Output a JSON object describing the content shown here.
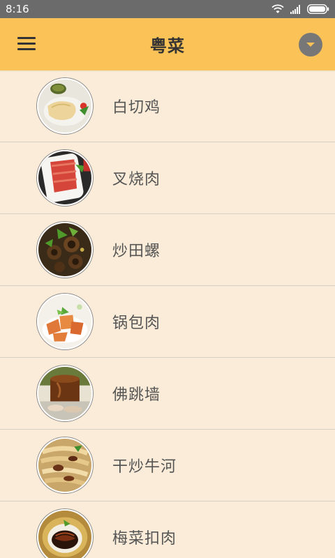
{
  "status_bar": {
    "time": "8:16"
  },
  "app_bar": {
    "title": "粤菜"
  },
  "dishes": [
    {
      "name": "白切鸡",
      "image": "white-cut-chicken"
    },
    {
      "name": "叉烧肉",
      "image": "char-siu-pork"
    },
    {
      "name": "炒田螺",
      "image": "stir-fried-snails"
    },
    {
      "name": "锅包肉",
      "image": "sweet-sour-pork"
    },
    {
      "name": "佛跳墙",
      "image": "buddha-jumps-wall"
    },
    {
      "name": "干炒牛河",
      "image": "beef-chow-fun"
    },
    {
      "name": "梅菜扣肉",
      "image": "braised-pork-preserved-veg"
    }
  ],
  "colors": {
    "status_bar": "#6b6b6b",
    "app_bar": "#fbc257",
    "background": "#faecd8",
    "divider": "#d8d0c6",
    "text": "#555555"
  }
}
